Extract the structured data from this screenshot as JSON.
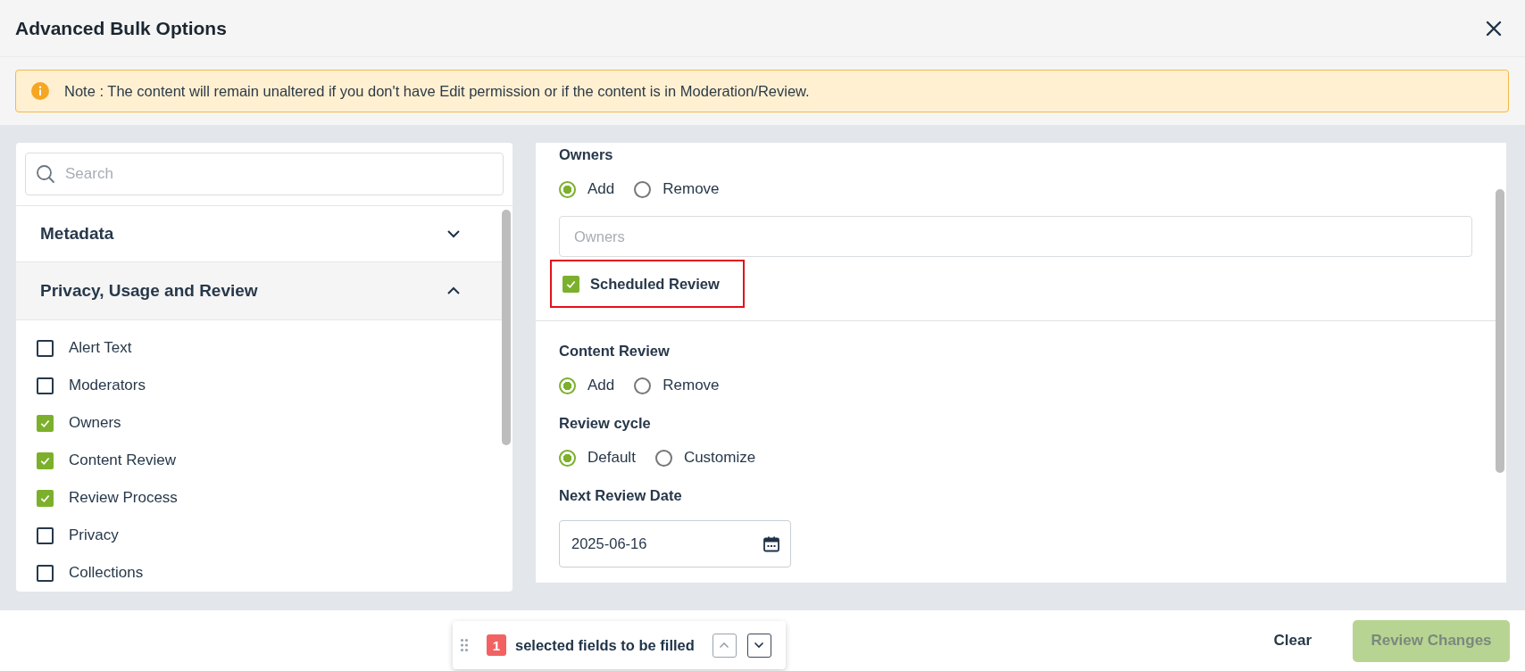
{
  "dialog": {
    "title": "Advanced Bulk Options"
  },
  "note": {
    "text": "Note : The content will remain unaltered if you don't have Edit permission or if the content is in Moderation/Review."
  },
  "search": {
    "placeholder": "Search"
  },
  "sections": [
    {
      "title": "Metadata",
      "expanded": false
    },
    {
      "title": "Privacy, Usage and Review",
      "expanded": true,
      "fields": [
        {
          "label": "Alert Text",
          "checked": false
        },
        {
          "label": "Moderators",
          "checked": false
        },
        {
          "label": "Owners",
          "checked": true
        },
        {
          "label": "Content Review",
          "checked": true
        },
        {
          "label": "Review Process",
          "checked": true
        },
        {
          "label": "Privacy",
          "checked": false
        },
        {
          "label": "Collections",
          "checked": false
        }
      ]
    }
  ],
  "form": [
    {
      "items": [
        {
          "kind": "heading",
          "text": "Owners"
        },
        {
          "kind": "radios",
          "options": [
            {
              "label": "Add",
              "selected": true
            },
            {
              "label": "Remove",
              "selected": false
            }
          ]
        },
        {
          "kind": "input",
          "placeholder": "Owners"
        },
        {
          "kind": "checkbox",
          "label": "Scheduled Review",
          "checked": true,
          "highlighted": true
        }
      ]
    },
    {
      "items": [
        {
          "kind": "heading",
          "text": "Content Review"
        },
        {
          "kind": "radios",
          "options": [
            {
              "label": "Add",
              "selected": true
            },
            {
              "label": "Remove",
              "selected": false
            }
          ]
        },
        {
          "kind": "heading",
          "text": "Review cycle"
        },
        {
          "kind": "radios",
          "options": [
            {
              "label": "Default",
              "selected": true
            },
            {
              "label": "Customize",
              "selected": false
            }
          ]
        },
        {
          "kind": "heading",
          "text": "Next Review Date"
        },
        {
          "kind": "date",
          "value": "2025-06-16"
        }
      ]
    }
  ],
  "footer": {
    "count": "1",
    "counter_text": "selected fields to be filled",
    "previous": {
      "disabled": true
    },
    "next": {
      "disabled": false
    },
    "clear": "Clear",
    "review": {
      "label": "Review Changes",
      "disabled": true
    }
  }
}
